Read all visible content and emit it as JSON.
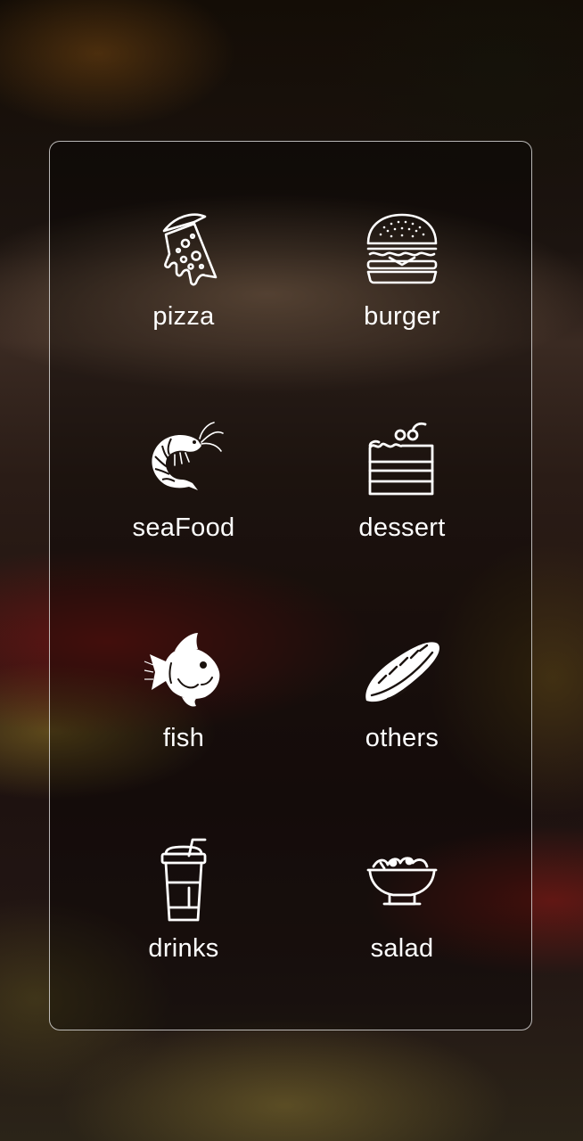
{
  "categories": [
    {
      "label": "pizza",
      "icon": "pizza-icon"
    },
    {
      "label": "burger",
      "icon": "burger-icon"
    },
    {
      "label": "seaFood",
      "icon": "shrimp-icon"
    },
    {
      "label": "dessert",
      "icon": "cake-icon"
    },
    {
      "label": "fish",
      "icon": "fish-icon"
    },
    {
      "label": "others",
      "icon": "baguette-icon"
    },
    {
      "label": "drinks",
      "icon": "drink-cup-icon"
    },
    {
      "label": "salad",
      "icon": "salad-bowl-icon"
    }
  ],
  "colors": {
    "text": "#ffffff",
    "card_border": "#ffffff"
  }
}
